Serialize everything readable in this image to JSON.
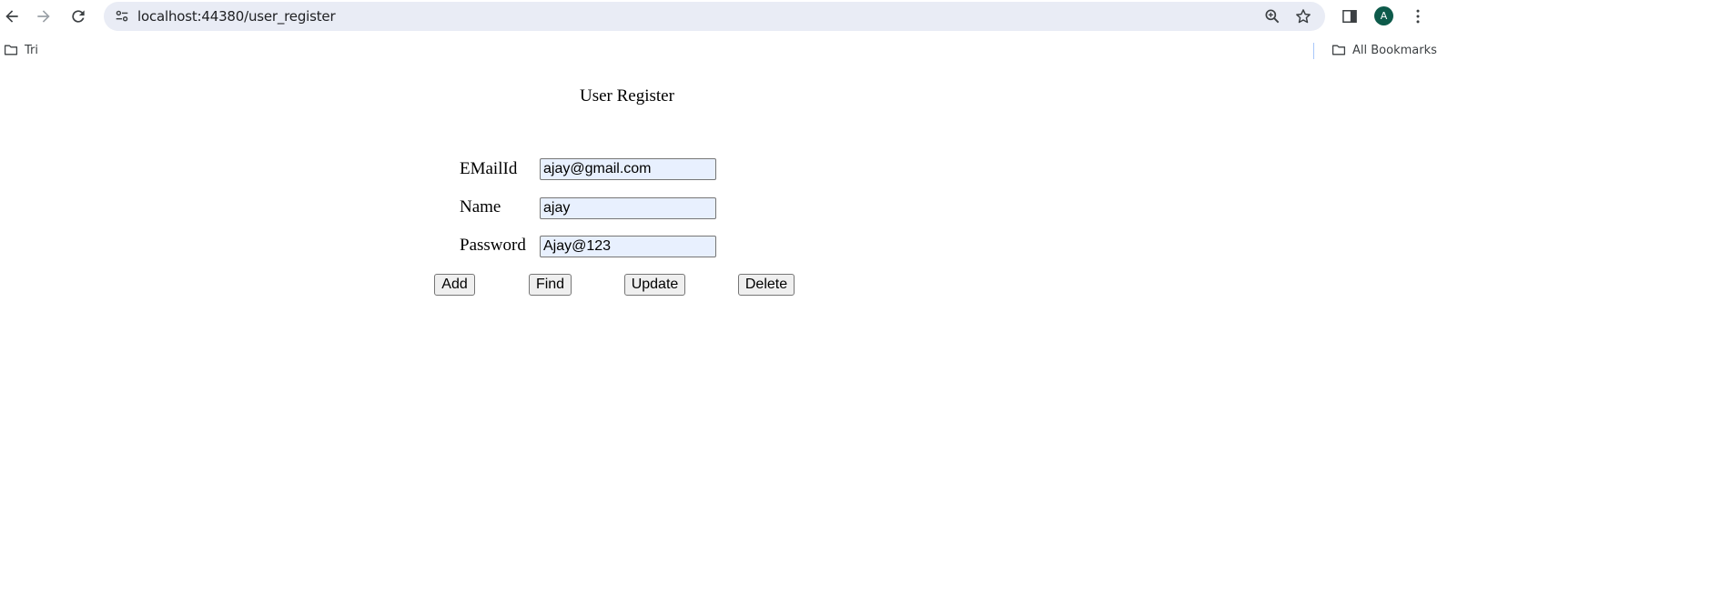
{
  "browser": {
    "url": "localhost:44380/user_register",
    "avatar_letter": "A",
    "bookmarks": [
      {
        "label": "Tri"
      }
    ],
    "all_bookmarks_label": "All Bookmarks"
  },
  "page": {
    "title": "User Register",
    "fields": [
      {
        "label": "EMailId",
        "value": "ajay@gmail.com"
      },
      {
        "label": "Name",
        "value": "ajay"
      },
      {
        "label": "Password",
        "value": "Ajay@123"
      }
    ],
    "buttons": {
      "add": "Add",
      "find": "Find",
      "update": "Update",
      "delete": "Delete"
    }
  },
  "colors": {
    "avatar_bg": "#0d5a4a",
    "omnibox_bg": "#e9ecf5",
    "autofill_bg": "#e8f0fe"
  }
}
